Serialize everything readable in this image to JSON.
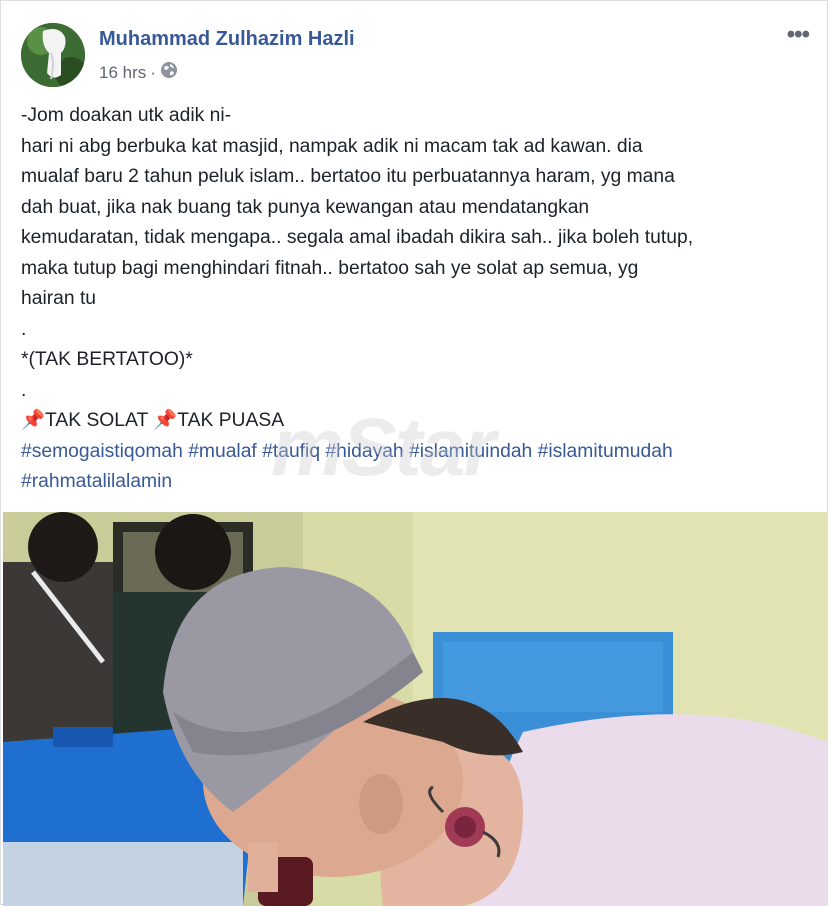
{
  "post": {
    "author": "Muhammad Zulhazim Hazli",
    "time": "16 hrs",
    "separator": "·",
    "more_label": "•••",
    "lines": [
      "-Jom doakan utk adik ni-",
      "hari ni abg berbuka kat masjid, nampak adik ni macam tak ad kawan. dia",
      "mualaf baru 2 tahun peluk islam.. bertatoo itu perbuatannya haram, yg mana",
      "dah buat, jika nak buang tak punya kewangan atau mendatangkan",
      "kemudaratan, tidak mengapa.. segala amal ibadah dikira sah.. jika boleh tutup,",
      "maka tutup bagi menghindari fitnah.. bertatoo sah ye solat ap semua, yg",
      "hairan tu",
      ".",
      "*(TAK BERTATOO)*",
      "."
    ],
    "tags_line": {
      "item1": "TAK SOLAT",
      "item2": "TAK PUASA"
    },
    "hashtags_line1": "#semogaistiqomah #mualaf #taufiq #hidayah #islamituindah #islamitumudah",
    "hashtags_line2": "#rahmatalilalamin",
    "watermark": "mStar"
  },
  "colors": {
    "author": "#385898",
    "hashtag": "#385898",
    "text": "#1d2129"
  }
}
